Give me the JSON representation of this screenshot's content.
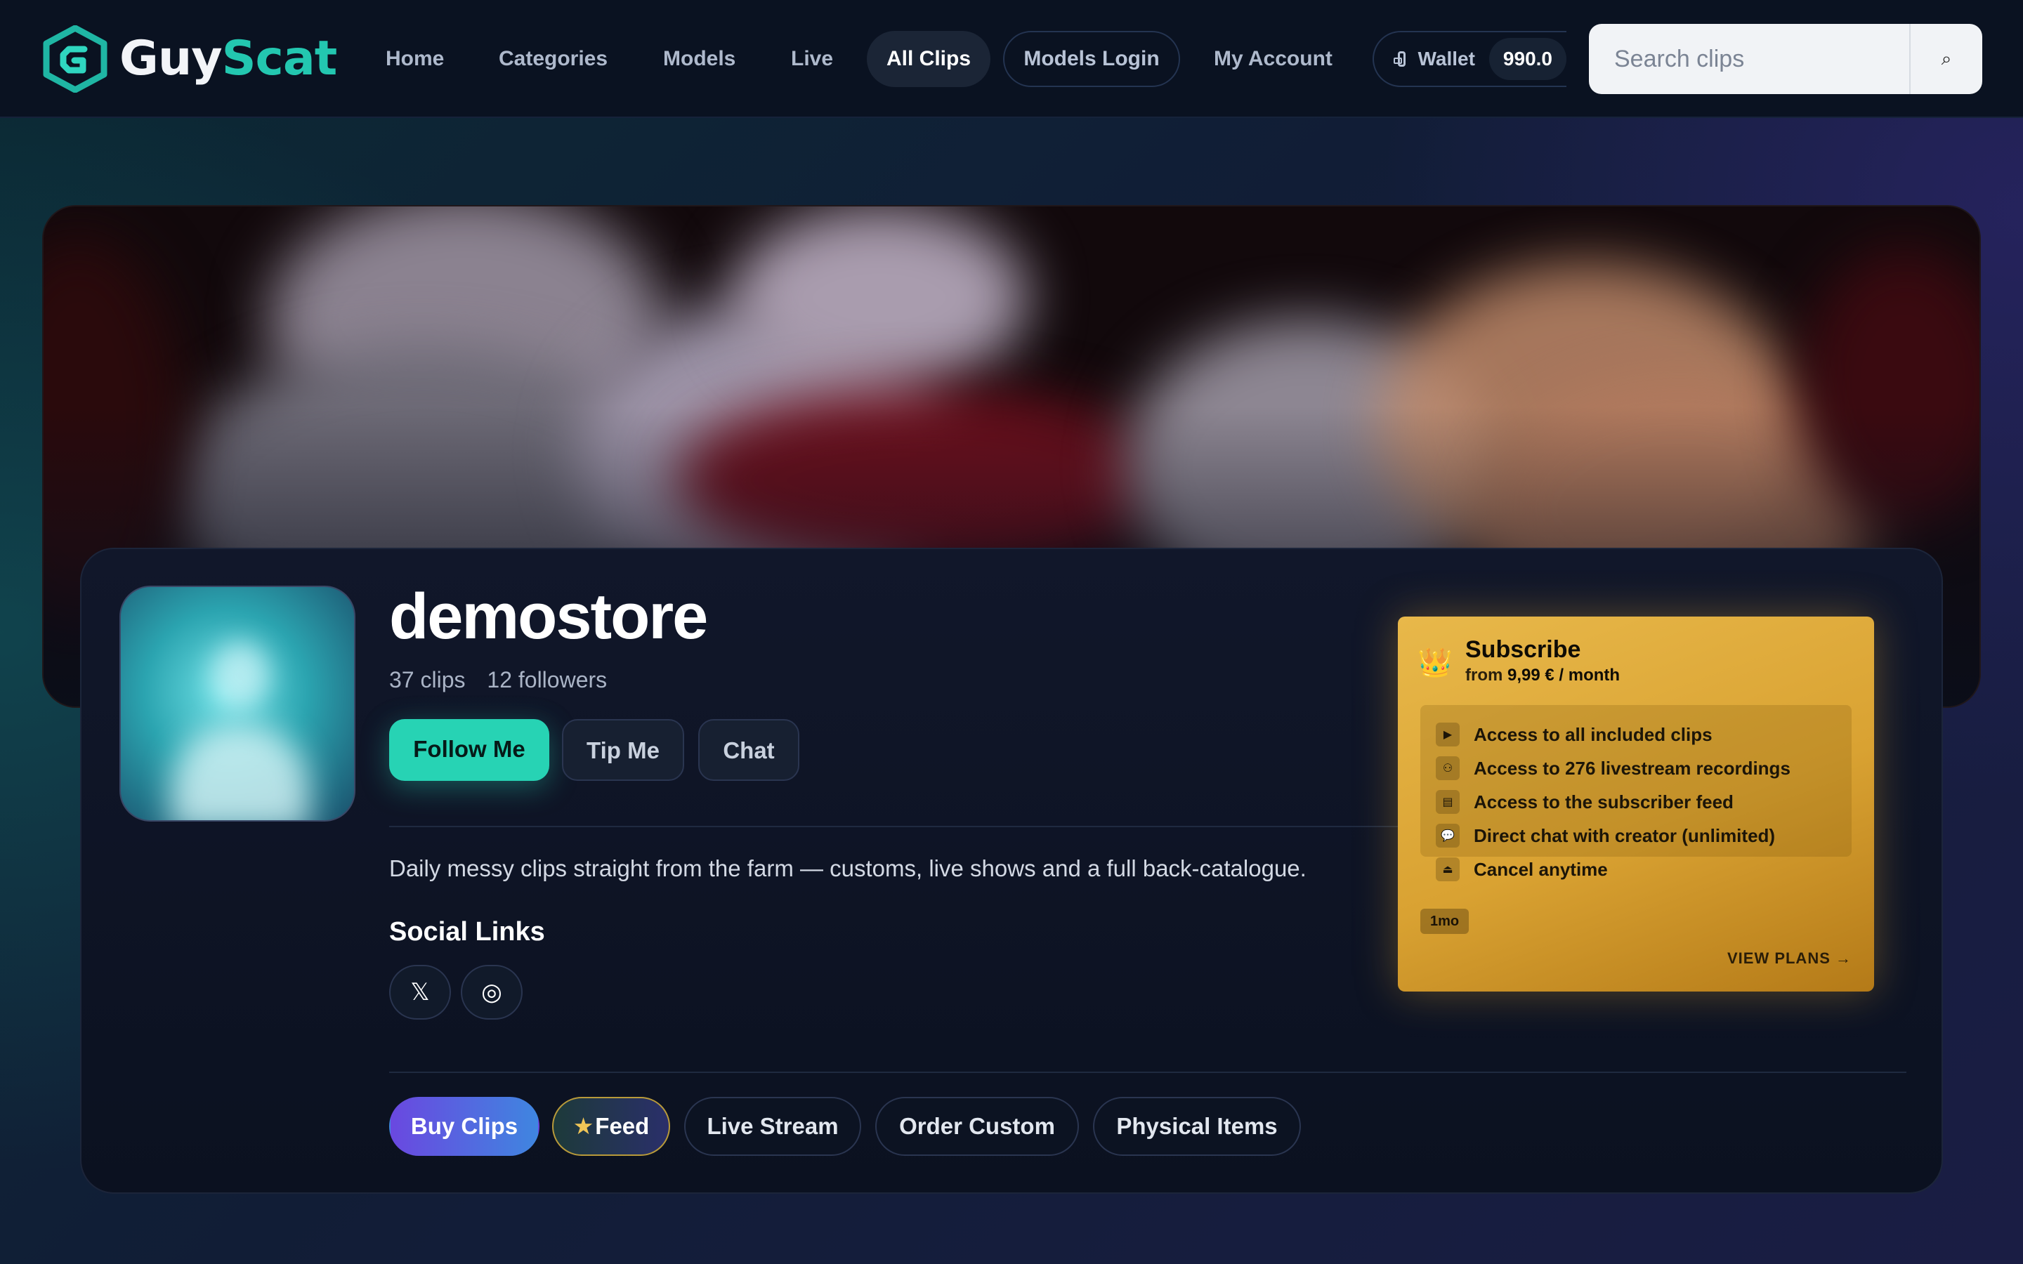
{
  "brand": {
    "name_part1": "Guy",
    "name_part2": "Scat"
  },
  "nav": {
    "home": "Home",
    "categories": "Categories",
    "models": "Models",
    "live": "Live",
    "all_clips": "All Clips",
    "models_login": "Models Login",
    "my_account": "My Account"
  },
  "wallet": {
    "label": "Wallet",
    "balance": "990.0"
  },
  "search": {
    "placeholder": "Search clips",
    "button_icon": "⌕"
  },
  "profile": {
    "username": "demostore",
    "clips": "37 clips",
    "followers": "12 followers",
    "follow_label": "Follow Me",
    "tip_label": "Tip Me",
    "chat_label": "Chat",
    "bio": "Daily messy clips straight from the farm — customs, live shows and a full back-catalogue.",
    "social_title": "Social Links",
    "social": [
      {
        "icon": "x-icon",
        "glyph": "𝕏"
      },
      {
        "icon": "instagram-icon",
        "glyph": "◎"
      }
    ]
  },
  "subscribe": {
    "title": "Subscribe",
    "price_prefix": "from",
    "price": "9,99 € / month",
    "perks": [
      {
        "icon": "play-icon",
        "glyph": "▶",
        "text": "Access to all included clips"
      },
      {
        "icon": "livestream-icon",
        "glyph": "⚇",
        "text": "Access to 276 livestream recordings"
      },
      {
        "icon": "feed-icon",
        "glyph": "▤",
        "text": "Access to the subscriber feed"
      },
      {
        "icon": "chat-bubble-icon",
        "glyph": "💬",
        "text": "Direct chat with creator (unlimited)"
      },
      {
        "icon": "eject-icon",
        "glyph": "⏏",
        "text": "Cancel anytime"
      }
    ],
    "plan_chip": "1mo",
    "view_plans": "VIEW PLANS →"
  },
  "tabs": {
    "buy_clips": "Buy Clips",
    "feed": "Feed",
    "live_stream": "Live Stream",
    "order_custom": "Order Custom",
    "physical_items": "Physical Items"
  },
  "colors": {
    "accent": "#27d3b4",
    "brand_teal": "#23c7b0",
    "gold": "#e0ad40",
    "purple": "#6a48e0"
  }
}
